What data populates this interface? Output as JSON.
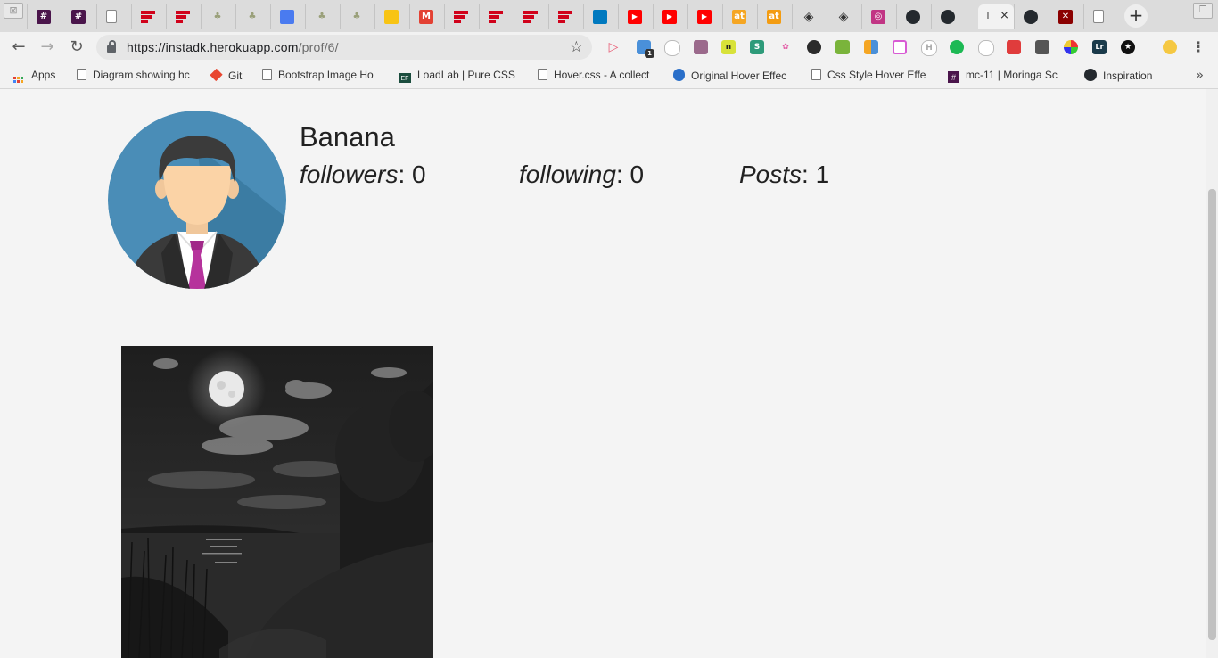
{
  "browser": {
    "tabs": [
      {
        "icon": "hashtag-slack-icon",
        "label": "#",
        "color": "#4a154b"
      },
      {
        "icon": "hashtag-slack-icon",
        "label": "#",
        "color": "#4a154b"
      },
      {
        "icon": "blank-page-icon",
        "label": "",
        "color": "#ffffff"
      },
      {
        "icon": "red-bars-icon",
        "label": "",
        "color": "#d0021b"
      },
      {
        "icon": "red-bars-icon",
        "label": "",
        "color": "#d0021b"
      },
      {
        "icon": "palm-tree-icon",
        "label": "",
        "color": "#9aa07a"
      },
      {
        "icon": "palm-tree-icon",
        "label": "",
        "color": "#9aa07a"
      },
      {
        "icon": "docs-icon",
        "label": "",
        "color": "#4a7bf0"
      },
      {
        "icon": "palm-tree-icon",
        "label": "",
        "color": "#9aa07a"
      },
      {
        "icon": "palm-tree-icon",
        "label": "",
        "color": "#9aa07a"
      },
      {
        "icon": "keep-bulb-icon",
        "label": "",
        "color": "#f8c414"
      },
      {
        "icon": "gmail-icon",
        "label": "M",
        "color": "#e34133"
      },
      {
        "icon": "red-bars-icon",
        "label": "",
        "color": "#d0021b"
      },
      {
        "icon": "red-bars-icon",
        "label": "",
        "color": "#d0021b"
      },
      {
        "icon": "red-bars-icon",
        "label": "",
        "color": "#d0021b"
      },
      {
        "icon": "red-bars-icon",
        "label": "",
        "color": "#d0021b"
      },
      {
        "icon": "trello-icon",
        "label": "",
        "color": "#0079bf"
      },
      {
        "icon": "youtube-icon",
        "label": "▶",
        "color": "#ff0000"
      },
      {
        "icon": "youtube-icon",
        "label": "▶",
        "color": "#ff0000"
      },
      {
        "icon": "youtube-icon",
        "label": "▶",
        "color": "#ff0000"
      },
      {
        "icon": "alltop-icon",
        "label": "at",
        "color": "#f5a623"
      },
      {
        "icon": "alltop-icon",
        "label": "at",
        "color": "#f39c12"
      },
      {
        "icon": "codepen-icon",
        "label": "◈",
        "color": "#333333"
      },
      {
        "icon": "codepen-icon",
        "label": "◈",
        "color": "#333333"
      },
      {
        "icon": "instagram-icon",
        "label": "◎",
        "color": "#c13584"
      },
      {
        "icon": "github-icon",
        "label": "●",
        "color": "#24292e"
      },
      {
        "icon": "github-icon",
        "label": "●",
        "color": "#24292e"
      }
    ],
    "active_tab": {
      "label": "I",
      "close": "×"
    },
    "after_active_tabs": [
      {
        "icon": "github-icon",
        "label": "●",
        "color": "#24292e"
      },
      {
        "icon": "red-cross-icon",
        "label": "✕",
        "color": "#8b0000"
      },
      {
        "icon": "blank-page-icon",
        "label": "",
        "color": "#ffffff"
      }
    ],
    "new_tab": "+",
    "url_host": "https://instadk.herokuapp.com",
    "url_path": "/prof/6/",
    "bookmarks": [
      {
        "label": "Apps",
        "icon": "apps-grid-icon"
      },
      {
        "label": "Diagram showing hc",
        "icon": "blank-page-icon"
      },
      {
        "label": "Git",
        "icon": "git-icon"
      },
      {
        "label": "Bootstrap Image Ho",
        "icon": "blank-page-icon"
      },
      {
        "label": "LoadLab | Pure CSS",
        "icon": "ef-icon"
      },
      {
        "label": "Hover.css - A collect",
        "icon": "blank-page-icon"
      },
      {
        "label": "Original Hover Effec",
        "icon": "drop-icon"
      },
      {
        "label": "Css Style Hover Effe",
        "icon": "blank-page-icon"
      },
      {
        "label": "mc-11 | Moringa Sc",
        "icon": "hashtag-slack-icon"
      },
      {
        "label": "Inspiration",
        "icon": "github-icon"
      }
    ],
    "more_bookmarks": "»",
    "extension_badge": "1"
  },
  "profile": {
    "username": "Banana",
    "stats": [
      {
        "label": "followers",
        "sep": ": ",
        "value": "0"
      },
      {
        "label": "following",
        "sep": ": ",
        "value": "0"
      },
      {
        "label": "Posts",
        "sep": ": ",
        "value": "1"
      }
    ]
  },
  "colors": {
    "avatar_bg": "#4a8db7",
    "tie": "#b6339c",
    "page_bg": "#f4f4f4"
  }
}
